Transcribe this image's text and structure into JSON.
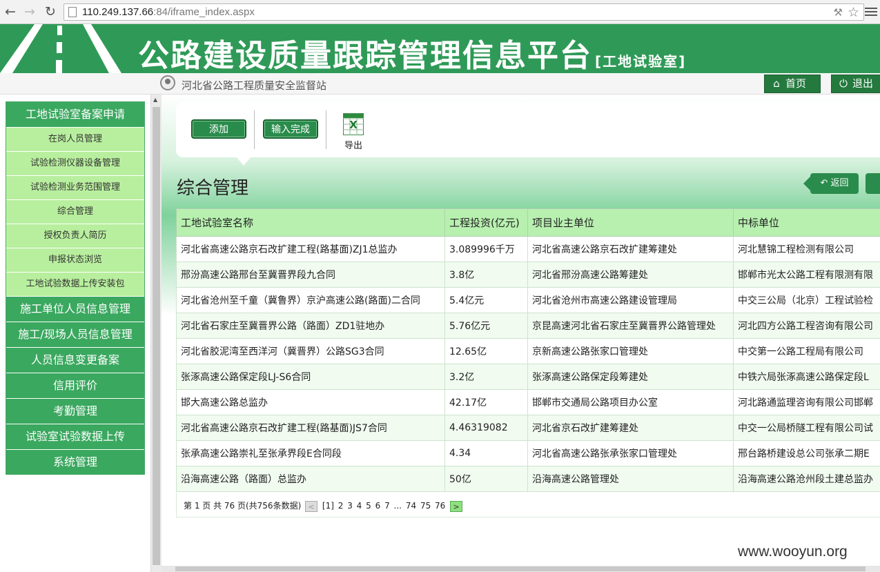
{
  "browser": {
    "url_host": "110.249.137.66",
    "url_rest": ":84/iframe_index.aspx"
  },
  "header": {
    "title": "公路建设质量跟踪管理信息平台",
    "subtitle": "[工地试验室]",
    "org": "河北省公路工程质量安全监督站",
    "home_label": "首页",
    "logout_label": "退出"
  },
  "sidebar": {
    "section": "工地试验室备案申请",
    "sub_items": [
      "在岗人员管理",
      "试验检测仪器设备管理",
      "试验检测业务范围管理",
      "综合管理",
      "授权负责人简历",
      "申报状态浏览",
      "工地试验数据上传安装包"
    ],
    "main_items": [
      "施工单位人员信息管理",
      "施工/现场人员信息管理",
      "人员信息变更备案",
      "信用评价",
      "考勤管理",
      "试验室试验数据上传",
      "系统管理"
    ]
  },
  "toolbar": {
    "add_label": "添加",
    "done_label": "输入完成",
    "export_label": "导出"
  },
  "page": {
    "title": "综合管理",
    "back_label": "返回"
  },
  "table": {
    "headers": [
      "工地试验室名称",
      "工程投资(亿元)",
      "项目业主单位",
      "中标单位"
    ],
    "rows": [
      [
        "河北省高速公路京石改扩建工程(路基面)ZJ1总监办",
        "3.089996千万",
        "河北省高速公路京石改扩建筹建处",
        "河北慧锦工程检测有限公司"
      ],
      [
        "邢汾高速公路邢台至冀晋界段九合同",
        "3.8亿",
        "河北省邢汾高速公路筹建处",
        "邯郸市光太公路工程有限测有限"
      ],
      [
        "河北省沧州至千童（冀鲁界）京沪高速公路(路面)二合同",
        "5.4亿元",
        "河北省沧州市高速公路建设管理局",
        "中交三公局（北京）工程试验检"
      ],
      [
        "河北省石家庄至冀晋界公路（路面）ZD1驻地办",
        "5.76亿元",
        "京昆高速河北省石家庄至冀晋界公路管理处",
        "河北四方公路工程咨询有限公司"
      ],
      [
        "河北省胶泥湾至西洋河（冀晋界）公路SG3合同",
        "12.65亿",
        "京新高速公路张家口管理处",
        "中交第一公路工程局有限公司"
      ],
      [
        "张涿高速公路保定段LJ-S6合同",
        "3.2亿",
        "张涿高速公路保定段筹建处",
        "中铁六局张涿高速公路保定段L"
      ],
      [
        "邯大高速公路总监办",
        "42.17亿",
        "邯郸市交通局公路项目办公室",
        "河北路通监理咨询有限公司邯郸"
      ],
      [
        "河北省高速公路京石改扩建工程(路基面)JS7合同",
        "4.46319082",
        "河北省京石改扩建筹建处",
        "中交一公局桥隧工程有限公司试"
      ],
      [
        "张承高速公路崇礼至张承界段E合同段",
        "4.34",
        "河北省高速公路张承张家口管理处",
        "邢台路桥建设总公司张承二期E"
      ],
      [
        "沿海高速公路（路面）总监办",
        "50亿",
        "沿海高速公路管理处",
        "沿海高速公路沧州段土建总监办"
      ]
    ]
  },
  "pager": {
    "info": "第 1 页 共 76 页(共756条数据)",
    "current": "[1]",
    "pages": [
      "2",
      "3",
      "4",
      "5",
      "6",
      "7",
      "...",
      "74",
      "75",
      "76"
    ],
    "prev": "<",
    "next": ">"
  },
  "watermark": "www.wooyun.org",
  "colors": {
    "brand_green": "#2f9a57",
    "sidebar_sub": "#b8ef9e",
    "table_header": "#b8f0b0"
  }
}
